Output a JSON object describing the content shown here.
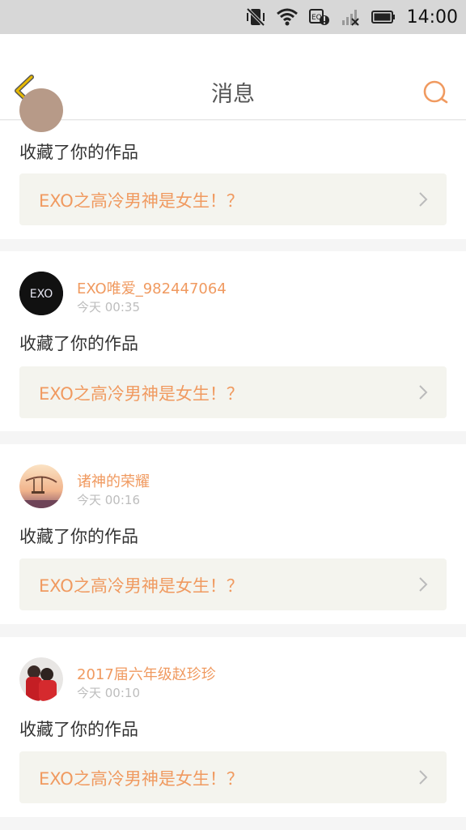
{
  "status_bar": {
    "time": "14:00",
    "icons": [
      "vibrate-off-icon",
      "wifi-icon",
      "notification-alert-icon",
      "signal-off-icon",
      "battery-icon"
    ]
  },
  "header": {
    "title": "消息",
    "back_icon": "chevron-left-icon",
    "search_icon": "search-icon"
  },
  "colors": {
    "accent": "#f09a60",
    "header_back": "#e6b800",
    "card_link_bg": "#f4f4ee",
    "time_gray": "#bdbdbd"
  },
  "messages": [
    {
      "user": "",
      "time": "",
      "action": "收藏了你的作品",
      "work_title": "EXO之高冷男神是女生！？",
      "avatar": "partial-avatar"
    },
    {
      "user": "EXO唯爱_982447064",
      "time": "今天 00:35",
      "action": "收藏了你的作品",
      "work_title": "EXO之高冷男神是女生！？",
      "avatar": "exo-logo-avatar",
      "avatar_text": "EXO"
    },
    {
      "user": "诸神的荣耀",
      "time": "今天 00:16",
      "action": "收藏了你的作品",
      "work_title": "EXO之高冷男神是女生！？",
      "avatar": "sunset-swing-avatar"
    },
    {
      "user": "2017届六年级赵珍珍",
      "time": "今天 00:10",
      "action": "收藏了你的作品",
      "work_title": "EXO之高冷男神是女生！？",
      "avatar": "couple-photo-avatar"
    }
  ]
}
